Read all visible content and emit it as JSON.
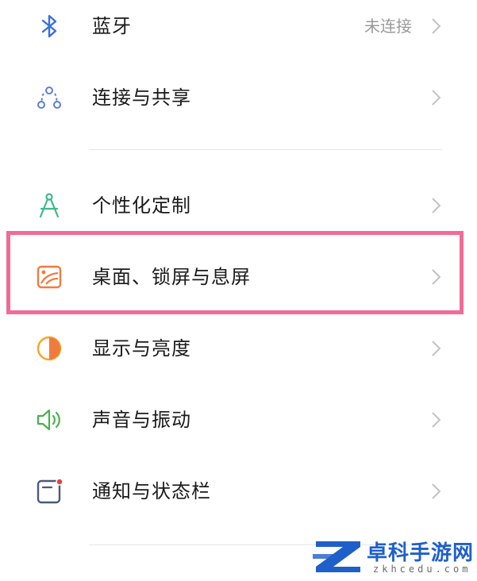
{
  "settings": {
    "items": [
      {
        "label": "蓝牙",
        "value": "未连接",
        "icon": "bluetooth-icon"
      },
      {
        "label": "连接与共享",
        "icon": "connection-share-icon"
      },
      {
        "label": "个性化定制",
        "icon": "compass-icon"
      },
      {
        "label": "桌面、锁屏与息屏",
        "icon": "wallpaper-icon",
        "highlighted": true
      },
      {
        "label": "显示与亮度",
        "icon": "brightness-icon"
      },
      {
        "label": "声音与振动",
        "icon": "speaker-icon"
      },
      {
        "label": "通知与状态栏",
        "icon": "notification-icon"
      }
    ]
  },
  "colors": {
    "highlight_border": "#f26b95",
    "bluetooth": "#3a6fd8",
    "connection": "#5b7fd6",
    "compass": "#3fb98a",
    "wallpaper": "#f07b3f",
    "brightness": "#f5a623",
    "speaker": "#4caf50",
    "notification": "#4a5a7a",
    "notification_dot": "#e8403f",
    "watermark": "#1f5fc9"
  },
  "watermark": {
    "title": "卓科手游网",
    "subtitle": "zkhcedu.com"
  }
}
